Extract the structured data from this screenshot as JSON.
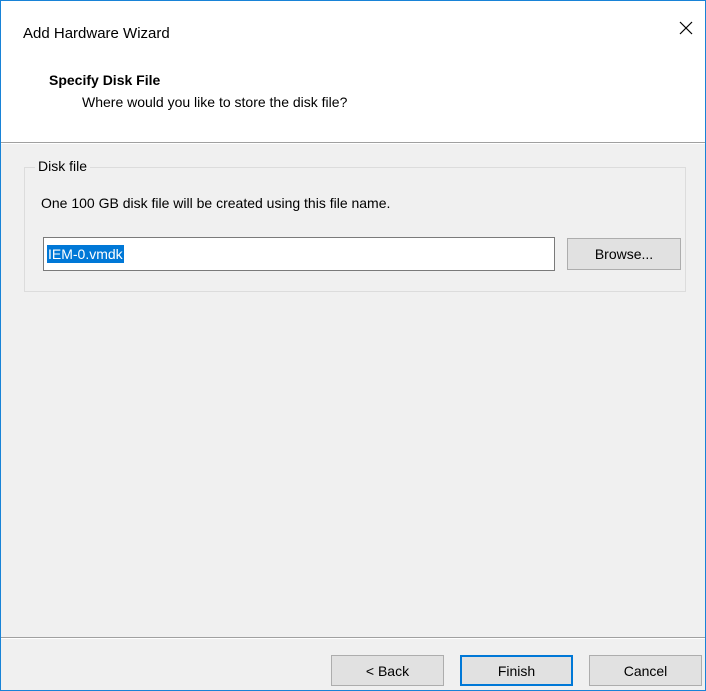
{
  "window": {
    "title": "Add Hardware Wizard",
    "close_glyph": "✕"
  },
  "header": {
    "title": "Specify Disk File",
    "subtitle": "Where would you like to store the disk file?"
  },
  "disk_file_group": {
    "legend": "Disk file",
    "description": "One 100 GB disk file will be created using this file name.",
    "file_name_value": "IEM-0.vmdk",
    "browse_label": "Browse..."
  },
  "footer": {
    "back_label": "< Back",
    "finish_label": "Finish",
    "cancel_label": "Cancel"
  },
  "colors": {
    "accent": "#0078d7",
    "window_border": "#1883d7",
    "dialog_background": "#f0f0f0",
    "button_background": "#e1e1e1"
  },
  "icons": {
    "close": "close-icon"
  }
}
